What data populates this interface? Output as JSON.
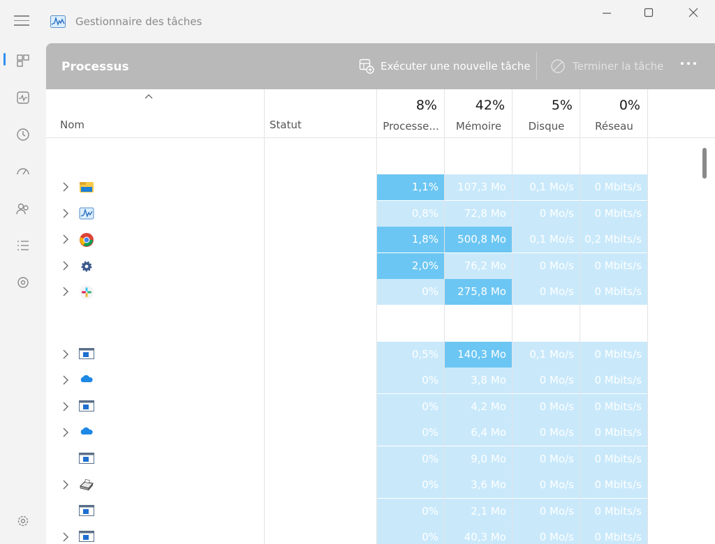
{
  "window": {
    "title": "Gestionnaire des tâches",
    "icon": "taskmanager-icon"
  },
  "sidebar": {
    "items": [
      {
        "icon": "processes-icon",
        "active": true
      },
      {
        "icon": "performance-icon"
      },
      {
        "icon": "history-icon"
      },
      {
        "icon": "startup-icon"
      },
      {
        "icon": "users-icon"
      },
      {
        "icon": "details-icon"
      },
      {
        "icon": "services-icon"
      }
    ],
    "settings_icon": "settings-icon"
  },
  "header": {
    "title": "Processus",
    "run_task_label": "Exécuter une nouvelle tâche",
    "end_task_label": "Terminer la tâche"
  },
  "columns": {
    "name": "Nom",
    "status": "Statut",
    "cpu": {
      "percent": "8%",
      "label": "Processe..."
    },
    "memory": {
      "percent": "42%",
      "label": "Mémoire"
    },
    "disk": {
      "percent": "5%",
      "label": "Disque"
    },
    "network": {
      "percent": "0%",
      "label": "Réseau"
    }
  },
  "colors": {
    "heat_light": "#c9e9fb",
    "heat_medium": "#a9dcf8",
    "heat_strong": "#6cc6f3",
    "header_bg": "#b9b9b9"
  },
  "rows": [
    {
      "icon": "explorer-icon",
      "expand": true,
      "cpu": "1,1%",
      "mem": "107,3 Mo",
      "disk": "0,1 Mo/s",
      "net": "0 Mbits/s",
      "cpu_heat": "strong",
      "mem_heat": "light"
    },
    {
      "icon": "taskmanager-icon",
      "expand": true,
      "cpu": "0,8%",
      "mem": "72,8 Mo",
      "disk": "0 Mo/s",
      "net": "0 Mbits/s",
      "cpu_heat": "light",
      "mem_heat": "light"
    },
    {
      "icon": "chrome-icon",
      "expand": true,
      "cpu": "1,8%",
      "mem": "500,8 Mo",
      "disk": "0,1 Mo/s",
      "net": "0,2 Mbits/s",
      "cpu_heat": "strong",
      "mem_heat": "strong"
    },
    {
      "icon": "settings-gear-icon",
      "expand": true,
      "cpu": "2,0%",
      "mem": "76,2 Mo",
      "disk": "0 Mo/s",
      "net": "0 Mbits/s",
      "cpu_heat": "strong",
      "mem_heat": "light"
    },
    {
      "icon": "slack-icon",
      "expand": true,
      "cpu": "0%",
      "mem": "275,8 Mo",
      "disk": "0 Mo/s",
      "net": "0 Mbits/s",
      "cpu_heat": "light",
      "mem_heat": "strong"
    },
    {
      "gap": true
    },
    {
      "icon": "window-app-icon",
      "expand": true,
      "cpu": "0,5%",
      "mem": "140,3 Mo",
      "disk": "0,1 Mo/s",
      "net": "0 Mbits/s",
      "cpu_heat": "light",
      "mem_heat": "strong"
    },
    {
      "icon": "onedrive-icon",
      "expand": true,
      "cpu": "0%",
      "mem": "3,8 Mo",
      "disk": "0 Mo/s",
      "net": "0 Mbits/s",
      "cpu_heat": "light",
      "mem_heat": "light"
    },
    {
      "icon": "window-app-icon",
      "expand": true,
      "cpu": "0%",
      "mem": "4,2 Mo",
      "disk": "0 Mo/s",
      "net": "0 Mbits/s",
      "cpu_heat": "light",
      "mem_heat": "light"
    },
    {
      "icon": "onedrive-icon",
      "expand": true,
      "cpu": "0%",
      "mem": "6,4 Mo",
      "disk": "0 Mo/s",
      "net": "0 Mbits/s",
      "cpu_heat": "light",
      "mem_heat": "light"
    },
    {
      "icon": "window-app-icon",
      "expand": false,
      "cpu": "0%",
      "mem": "9,0 Mo",
      "disk": "0 Mo/s",
      "net": "0 Mbits/s",
      "cpu_heat": "light",
      "mem_heat": "light"
    },
    {
      "icon": "printer-icon",
      "expand": true,
      "cpu": "0%",
      "mem": "3,6 Mo",
      "disk": "0 Mo/s",
      "net": "0 Mbits/s",
      "cpu_heat": "light",
      "mem_heat": "light"
    },
    {
      "icon": "window-app-icon",
      "expand": false,
      "cpu": "0%",
      "mem": "2,1 Mo",
      "disk": "0 Mo/s",
      "net": "0 Mbits/s",
      "cpu_heat": "light",
      "mem_heat": "light"
    },
    {
      "icon": "window-app-icon",
      "expand": true,
      "cpu": "0%",
      "mem": "40,3 Mo",
      "disk": "0 Mo/s",
      "net": "0 Mbits/s",
      "cpu_heat": "light",
      "mem_heat": "light"
    }
  ]
}
